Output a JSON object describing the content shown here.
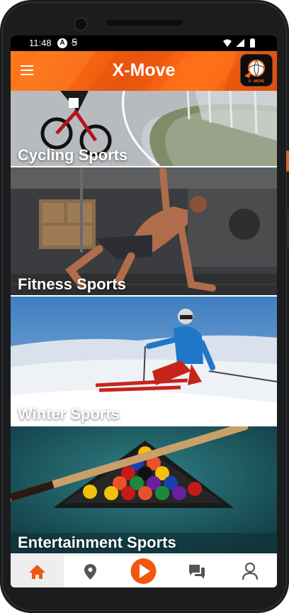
{
  "status_bar": {
    "time": "11:48",
    "notification_icons": [
      "a-circle-icon",
      "s-sync-icon"
    ],
    "system_icons": [
      "wifi-icon",
      "signal-icon",
      "battery-icon"
    ]
  },
  "app_bar": {
    "title": "X-Move",
    "menu_icon": "hamburger-menu-icon",
    "logo_text": "X - MOVE",
    "brand_color": "#f0570f"
  },
  "categories": [
    {
      "label": "Cycling Sports"
    },
    {
      "label": "Fitness Sports"
    },
    {
      "label": "Winter Sports"
    },
    {
      "label": "Entertainment Sports"
    }
  ],
  "bottom_nav": {
    "items": [
      {
        "icon": "home-icon",
        "active": true
      },
      {
        "icon": "location-pin-icon",
        "active": false
      },
      {
        "icon": "play-icon",
        "active": false
      },
      {
        "icon": "chat-icon",
        "active": false
      },
      {
        "icon": "profile-icon",
        "active": false
      }
    ],
    "accent_color": "#f0570f"
  }
}
